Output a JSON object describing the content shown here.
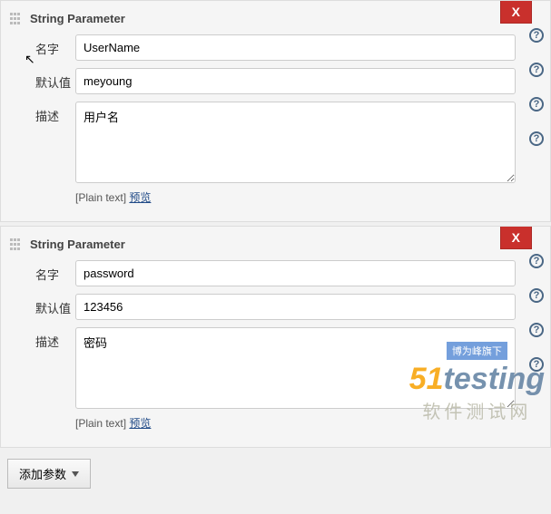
{
  "blocks": [
    {
      "title": "String Parameter",
      "delete": "X",
      "fields": {
        "name_label": "名字",
        "name_value": "UserName",
        "default_label": "默认值",
        "default_value": "meyoung",
        "desc_label": "描述",
        "desc_value": "用户名",
        "mode_text": "[Plain text]",
        "preview": "预览"
      }
    },
    {
      "title": "String Parameter",
      "delete": "X",
      "fields": {
        "name_label": "名字",
        "name_value": "password",
        "default_label": "默认值",
        "default_value": "123456",
        "desc_label": "描述",
        "desc_value": "密码",
        "mode_text": "[Plain text]",
        "preview": "预览"
      }
    }
  ],
  "add_button": "添加参数",
  "watermark": {
    "tag": "博为峰旗下",
    "brand_num": "51",
    "brand_text": "testing",
    "sub": "软件测试网"
  }
}
